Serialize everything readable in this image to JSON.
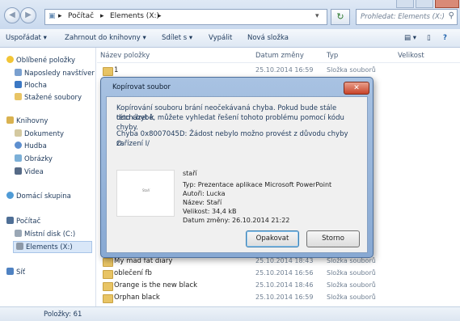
{
  "address": {
    "crumbs": [
      "Počítač",
      "Elements (X:)"
    ],
    "search_placeholder": "Prohledat: Elements (X:)"
  },
  "toolbar": {
    "items": [
      "Uspořádat ▾",
      "Zahrnout do knihovny ▾",
      "Sdílet s ▾",
      "Vypálit",
      "Nová složka"
    ]
  },
  "sidebar": {
    "favorites": "Oblíbené položky",
    "recent": "Naposledy navštíver",
    "desktop": "Plocha",
    "downloads": "Stažené soubory",
    "libraries": "Knihovny",
    "documents": "Dokumenty",
    "music": "Hudba",
    "pictures": "Obrázky",
    "videos": "Videa",
    "homegroup": "Domácí skupina",
    "computer": "Počítač",
    "local_disk": "Místní disk (C:)",
    "elements": "Elements (X:)",
    "network": "Síť"
  },
  "columns": [
    "Název položky",
    "Datum změny",
    "Typ",
    "Velikost"
  ],
  "rows": [
    {
      "name": "1",
      "date": "25.10.2014 16:59",
      "type": "Složka souborů"
    },
    {
      "name": "My mad fat diary",
      "date": "25.10.2014 18:43",
      "type": "Složka souborů"
    },
    {
      "name": "oblečení fb",
      "date": "25.10.2014 16:56",
      "type": "Složka souborů"
    },
    {
      "name": "Orange is the new black",
      "date": "25.10.2014 18:46",
      "type": "Složka souborů"
    },
    {
      "name": "Orphan black",
      "date": "25.10.2014 16:59",
      "type": "Složka souborů"
    }
  ],
  "status": {
    "items_count": "Položky: 61"
  },
  "dialog": {
    "title": "Kopírovat soubor",
    "close": "✕",
    "msg_line1": "Kopírování souboru brání neočekávaná chyba. Pokud bude stále docházet k",
    "msg_line2": "této chybě, můžete vyhledat řešení tohoto problému pomocí kódu chyby.",
    "err_line1": "Chyba 0x8007045D: Žádost nebylo možno provést z důvodu chyby zařízení I/",
    "err_line2": "O.",
    "file_name": "staří",
    "thumb_text": "Staří",
    "type": "Typ: Prezentace aplikace Microsoft PowerPoint",
    "authors": "Autoři: Lucka",
    "title_field": "Název: Staří",
    "size": "Velikost: 34,4 kB",
    "modified": "Datum změny: 26.10.2014 21:22",
    "ok_label": "Opakovat",
    "cancel_label": "Storno"
  },
  "colors": {
    "folder": "#e8c465",
    "accent": "#1e395b",
    "dialog_frame": "#a8c2e2"
  }
}
